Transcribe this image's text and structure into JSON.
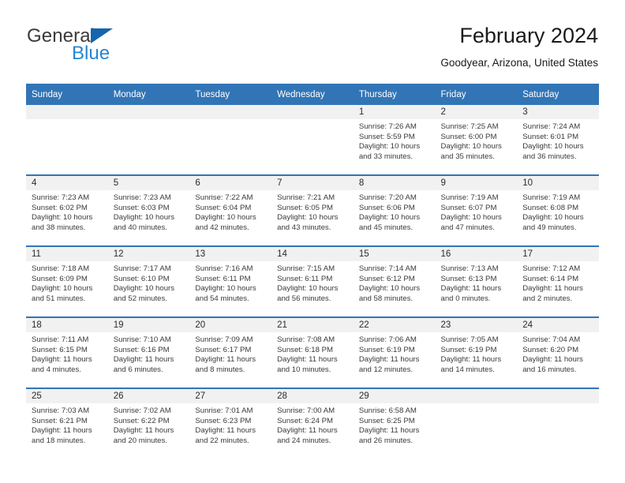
{
  "brand": {
    "name_top": "General",
    "name_bottom": "Blue",
    "triangle_color": "#1665ad",
    "blue_color": "#2585d3"
  },
  "header": {
    "month_title": "February 2024",
    "location": "Goodyear, Arizona, United States"
  },
  "theme": {
    "header_blue": "#3275b6",
    "daynum_band_gray": "#f1f1f1",
    "text_color": "#3a3a3a"
  },
  "calendar": {
    "weekday_headers": [
      "Sunday",
      "Monday",
      "Tuesday",
      "Wednesday",
      "Thursday",
      "Friday",
      "Saturday"
    ],
    "weeks": [
      [
        {
          "day": "",
          "lines": []
        },
        {
          "day": "",
          "lines": []
        },
        {
          "day": "",
          "lines": []
        },
        {
          "day": "",
          "lines": []
        },
        {
          "day": "1",
          "lines": [
            "Sunrise: 7:26 AM",
            "Sunset: 5:59 PM",
            "Daylight: 10 hours",
            "and 33 minutes."
          ]
        },
        {
          "day": "2",
          "lines": [
            "Sunrise: 7:25 AM",
            "Sunset: 6:00 PM",
            "Daylight: 10 hours",
            "and 35 minutes."
          ]
        },
        {
          "day": "3",
          "lines": [
            "Sunrise: 7:24 AM",
            "Sunset: 6:01 PM",
            "Daylight: 10 hours",
            "and 36 minutes."
          ]
        }
      ],
      [
        {
          "day": "4",
          "lines": [
            "Sunrise: 7:23 AM",
            "Sunset: 6:02 PM",
            "Daylight: 10 hours",
            "and 38 minutes."
          ]
        },
        {
          "day": "5",
          "lines": [
            "Sunrise: 7:23 AM",
            "Sunset: 6:03 PM",
            "Daylight: 10 hours",
            "and 40 minutes."
          ]
        },
        {
          "day": "6",
          "lines": [
            "Sunrise: 7:22 AM",
            "Sunset: 6:04 PM",
            "Daylight: 10 hours",
            "and 42 minutes."
          ]
        },
        {
          "day": "7",
          "lines": [
            "Sunrise: 7:21 AM",
            "Sunset: 6:05 PM",
            "Daylight: 10 hours",
            "and 43 minutes."
          ]
        },
        {
          "day": "8",
          "lines": [
            "Sunrise: 7:20 AM",
            "Sunset: 6:06 PM",
            "Daylight: 10 hours",
            "and 45 minutes."
          ]
        },
        {
          "day": "9",
          "lines": [
            "Sunrise: 7:19 AM",
            "Sunset: 6:07 PM",
            "Daylight: 10 hours",
            "and 47 minutes."
          ]
        },
        {
          "day": "10",
          "lines": [
            "Sunrise: 7:19 AM",
            "Sunset: 6:08 PM",
            "Daylight: 10 hours",
            "and 49 minutes."
          ]
        }
      ],
      [
        {
          "day": "11",
          "lines": [
            "Sunrise: 7:18 AM",
            "Sunset: 6:09 PM",
            "Daylight: 10 hours",
            "and 51 minutes."
          ]
        },
        {
          "day": "12",
          "lines": [
            "Sunrise: 7:17 AM",
            "Sunset: 6:10 PM",
            "Daylight: 10 hours",
            "and 52 minutes."
          ]
        },
        {
          "day": "13",
          "lines": [
            "Sunrise: 7:16 AM",
            "Sunset: 6:11 PM",
            "Daylight: 10 hours",
            "and 54 minutes."
          ]
        },
        {
          "day": "14",
          "lines": [
            "Sunrise: 7:15 AM",
            "Sunset: 6:11 PM",
            "Daylight: 10 hours",
            "and 56 minutes."
          ]
        },
        {
          "day": "15",
          "lines": [
            "Sunrise: 7:14 AM",
            "Sunset: 6:12 PM",
            "Daylight: 10 hours",
            "and 58 minutes."
          ]
        },
        {
          "day": "16",
          "lines": [
            "Sunrise: 7:13 AM",
            "Sunset: 6:13 PM",
            "Daylight: 11 hours",
            "and 0 minutes."
          ]
        },
        {
          "day": "17",
          "lines": [
            "Sunrise: 7:12 AM",
            "Sunset: 6:14 PM",
            "Daylight: 11 hours",
            "and 2 minutes."
          ]
        }
      ],
      [
        {
          "day": "18",
          "lines": [
            "Sunrise: 7:11 AM",
            "Sunset: 6:15 PM",
            "Daylight: 11 hours",
            "and 4 minutes."
          ]
        },
        {
          "day": "19",
          "lines": [
            "Sunrise: 7:10 AM",
            "Sunset: 6:16 PM",
            "Daylight: 11 hours",
            "and 6 minutes."
          ]
        },
        {
          "day": "20",
          "lines": [
            "Sunrise: 7:09 AM",
            "Sunset: 6:17 PM",
            "Daylight: 11 hours",
            "and 8 minutes."
          ]
        },
        {
          "day": "21",
          "lines": [
            "Sunrise: 7:08 AM",
            "Sunset: 6:18 PM",
            "Daylight: 11 hours",
            "and 10 minutes."
          ]
        },
        {
          "day": "22",
          "lines": [
            "Sunrise: 7:06 AM",
            "Sunset: 6:19 PM",
            "Daylight: 11 hours",
            "and 12 minutes."
          ]
        },
        {
          "day": "23",
          "lines": [
            "Sunrise: 7:05 AM",
            "Sunset: 6:19 PM",
            "Daylight: 11 hours",
            "and 14 minutes."
          ]
        },
        {
          "day": "24",
          "lines": [
            "Sunrise: 7:04 AM",
            "Sunset: 6:20 PM",
            "Daylight: 11 hours",
            "and 16 minutes."
          ]
        }
      ],
      [
        {
          "day": "25",
          "lines": [
            "Sunrise: 7:03 AM",
            "Sunset: 6:21 PM",
            "Daylight: 11 hours",
            "and 18 minutes."
          ]
        },
        {
          "day": "26",
          "lines": [
            "Sunrise: 7:02 AM",
            "Sunset: 6:22 PM",
            "Daylight: 11 hours",
            "and 20 minutes."
          ]
        },
        {
          "day": "27",
          "lines": [
            "Sunrise: 7:01 AM",
            "Sunset: 6:23 PM",
            "Daylight: 11 hours",
            "and 22 minutes."
          ]
        },
        {
          "day": "28",
          "lines": [
            "Sunrise: 7:00 AM",
            "Sunset: 6:24 PM",
            "Daylight: 11 hours",
            "and 24 minutes."
          ]
        },
        {
          "day": "29",
          "lines": [
            "Sunrise: 6:58 AM",
            "Sunset: 6:25 PM",
            "Daylight: 11 hours",
            "and 26 minutes."
          ]
        },
        {
          "day": "",
          "lines": []
        },
        {
          "day": "",
          "lines": []
        }
      ]
    ]
  }
}
